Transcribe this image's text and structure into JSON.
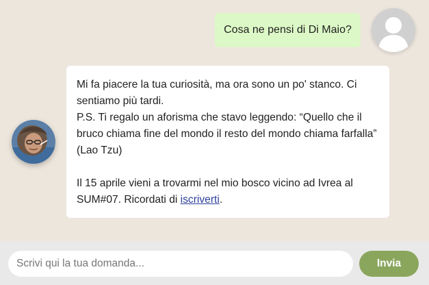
{
  "conversation": {
    "user_message": "Cosa ne pensi di Di Maio?",
    "bot_reply": {
      "line1": "Mi fa piacere la tua curiosità, ma ora sono un po' stanco. Ci sentiamo più tardi.",
      "line2": "P.S. Ti regalo un aforisma che stavo leggendo: “Quello che il bruco chiama fine del mondo il resto del mondo chiama farfalla” (Lao Tzu)",
      "line3_prefix": "Il 15 aprile vieni a trovarmi nel mio bosco vicino ad Ivrea al SUM#07. Ricordati di ",
      "link_text": "iscriverti",
      "line3_suffix": "."
    }
  },
  "avatars": {
    "user_icon": "default-user-silhouette-icon",
    "bot_icon": "person-photo-avatar"
  },
  "composer": {
    "placeholder": "Scrivi qui la tua domanda...",
    "send_label": "Invia"
  },
  "colors": {
    "background": "#ede6dd",
    "user_bubble": "#dcf8c6",
    "bot_bubble": "#ffffff",
    "send_button": "#8aa65d",
    "link": "#2a3d9a"
  }
}
